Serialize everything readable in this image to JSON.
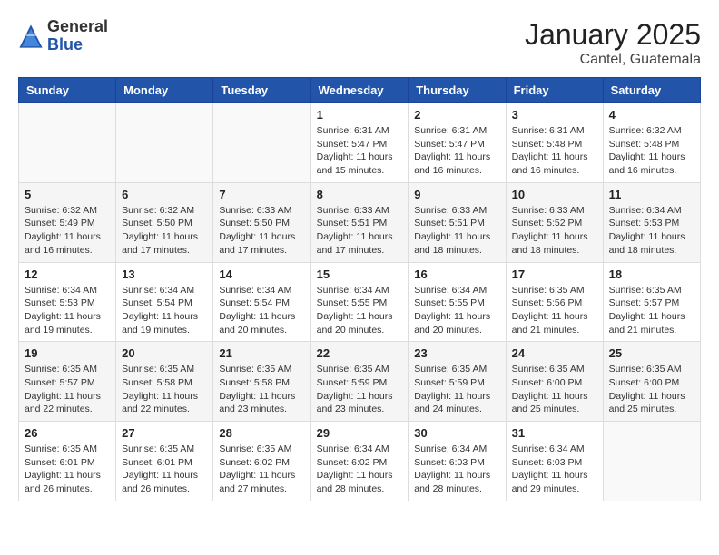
{
  "header": {
    "logo_general": "General",
    "logo_blue": "Blue",
    "month_title": "January 2025",
    "location": "Cantel, Guatemala"
  },
  "days_of_week": [
    "Sunday",
    "Monday",
    "Tuesday",
    "Wednesday",
    "Thursday",
    "Friday",
    "Saturday"
  ],
  "weeks": [
    [
      {
        "day": "",
        "sunrise": "",
        "sunset": "",
        "daylight": ""
      },
      {
        "day": "",
        "sunrise": "",
        "sunset": "",
        "daylight": ""
      },
      {
        "day": "",
        "sunrise": "",
        "sunset": "",
        "daylight": ""
      },
      {
        "day": "1",
        "sunrise": "Sunrise: 6:31 AM",
        "sunset": "Sunset: 5:47 PM",
        "daylight": "Daylight: 11 hours and 15 minutes."
      },
      {
        "day": "2",
        "sunrise": "Sunrise: 6:31 AM",
        "sunset": "Sunset: 5:47 PM",
        "daylight": "Daylight: 11 hours and 16 minutes."
      },
      {
        "day": "3",
        "sunrise": "Sunrise: 6:31 AM",
        "sunset": "Sunset: 5:48 PM",
        "daylight": "Daylight: 11 hours and 16 minutes."
      },
      {
        "day": "4",
        "sunrise": "Sunrise: 6:32 AM",
        "sunset": "Sunset: 5:48 PM",
        "daylight": "Daylight: 11 hours and 16 minutes."
      }
    ],
    [
      {
        "day": "5",
        "sunrise": "Sunrise: 6:32 AM",
        "sunset": "Sunset: 5:49 PM",
        "daylight": "Daylight: 11 hours and 16 minutes."
      },
      {
        "day": "6",
        "sunrise": "Sunrise: 6:32 AM",
        "sunset": "Sunset: 5:50 PM",
        "daylight": "Daylight: 11 hours and 17 minutes."
      },
      {
        "day": "7",
        "sunrise": "Sunrise: 6:33 AM",
        "sunset": "Sunset: 5:50 PM",
        "daylight": "Daylight: 11 hours and 17 minutes."
      },
      {
        "day": "8",
        "sunrise": "Sunrise: 6:33 AM",
        "sunset": "Sunset: 5:51 PM",
        "daylight": "Daylight: 11 hours and 17 minutes."
      },
      {
        "day": "9",
        "sunrise": "Sunrise: 6:33 AM",
        "sunset": "Sunset: 5:51 PM",
        "daylight": "Daylight: 11 hours and 18 minutes."
      },
      {
        "day": "10",
        "sunrise": "Sunrise: 6:33 AM",
        "sunset": "Sunset: 5:52 PM",
        "daylight": "Daylight: 11 hours and 18 minutes."
      },
      {
        "day": "11",
        "sunrise": "Sunrise: 6:34 AM",
        "sunset": "Sunset: 5:53 PM",
        "daylight": "Daylight: 11 hours and 18 minutes."
      }
    ],
    [
      {
        "day": "12",
        "sunrise": "Sunrise: 6:34 AM",
        "sunset": "Sunset: 5:53 PM",
        "daylight": "Daylight: 11 hours and 19 minutes."
      },
      {
        "day": "13",
        "sunrise": "Sunrise: 6:34 AM",
        "sunset": "Sunset: 5:54 PM",
        "daylight": "Daylight: 11 hours and 19 minutes."
      },
      {
        "day": "14",
        "sunrise": "Sunrise: 6:34 AM",
        "sunset": "Sunset: 5:54 PM",
        "daylight": "Daylight: 11 hours and 20 minutes."
      },
      {
        "day": "15",
        "sunrise": "Sunrise: 6:34 AM",
        "sunset": "Sunset: 5:55 PM",
        "daylight": "Daylight: 11 hours and 20 minutes."
      },
      {
        "day": "16",
        "sunrise": "Sunrise: 6:34 AM",
        "sunset": "Sunset: 5:55 PM",
        "daylight": "Daylight: 11 hours and 20 minutes."
      },
      {
        "day": "17",
        "sunrise": "Sunrise: 6:35 AM",
        "sunset": "Sunset: 5:56 PM",
        "daylight": "Daylight: 11 hours and 21 minutes."
      },
      {
        "day": "18",
        "sunrise": "Sunrise: 6:35 AM",
        "sunset": "Sunset: 5:57 PM",
        "daylight": "Daylight: 11 hours and 21 minutes."
      }
    ],
    [
      {
        "day": "19",
        "sunrise": "Sunrise: 6:35 AM",
        "sunset": "Sunset: 5:57 PM",
        "daylight": "Daylight: 11 hours and 22 minutes."
      },
      {
        "day": "20",
        "sunrise": "Sunrise: 6:35 AM",
        "sunset": "Sunset: 5:58 PM",
        "daylight": "Daylight: 11 hours and 22 minutes."
      },
      {
        "day": "21",
        "sunrise": "Sunrise: 6:35 AM",
        "sunset": "Sunset: 5:58 PM",
        "daylight": "Daylight: 11 hours and 23 minutes."
      },
      {
        "day": "22",
        "sunrise": "Sunrise: 6:35 AM",
        "sunset": "Sunset: 5:59 PM",
        "daylight": "Daylight: 11 hours and 23 minutes."
      },
      {
        "day": "23",
        "sunrise": "Sunrise: 6:35 AM",
        "sunset": "Sunset: 5:59 PM",
        "daylight": "Daylight: 11 hours and 24 minutes."
      },
      {
        "day": "24",
        "sunrise": "Sunrise: 6:35 AM",
        "sunset": "Sunset: 6:00 PM",
        "daylight": "Daylight: 11 hours and 25 minutes."
      },
      {
        "day": "25",
        "sunrise": "Sunrise: 6:35 AM",
        "sunset": "Sunset: 6:00 PM",
        "daylight": "Daylight: 11 hours and 25 minutes."
      }
    ],
    [
      {
        "day": "26",
        "sunrise": "Sunrise: 6:35 AM",
        "sunset": "Sunset: 6:01 PM",
        "daylight": "Daylight: 11 hours and 26 minutes."
      },
      {
        "day": "27",
        "sunrise": "Sunrise: 6:35 AM",
        "sunset": "Sunset: 6:01 PM",
        "daylight": "Daylight: 11 hours and 26 minutes."
      },
      {
        "day": "28",
        "sunrise": "Sunrise: 6:35 AM",
        "sunset": "Sunset: 6:02 PM",
        "daylight": "Daylight: 11 hours and 27 minutes."
      },
      {
        "day": "29",
        "sunrise": "Sunrise: 6:34 AM",
        "sunset": "Sunset: 6:02 PM",
        "daylight": "Daylight: 11 hours and 28 minutes."
      },
      {
        "day": "30",
        "sunrise": "Sunrise: 6:34 AM",
        "sunset": "Sunset: 6:03 PM",
        "daylight": "Daylight: 11 hours and 28 minutes."
      },
      {
        "day": "31",
        "sunrise": "Sunrise: 6:34 AM",
        "sunset": "Sunset: 6:03 PM",
        "daylight": "Daylight: 11 hours and 29 minutes."
      },
      {
        "day": "",
        "sunrise": "",
        "sunset": "",
        "daylight": ""
      }
    ]
  ]
}
